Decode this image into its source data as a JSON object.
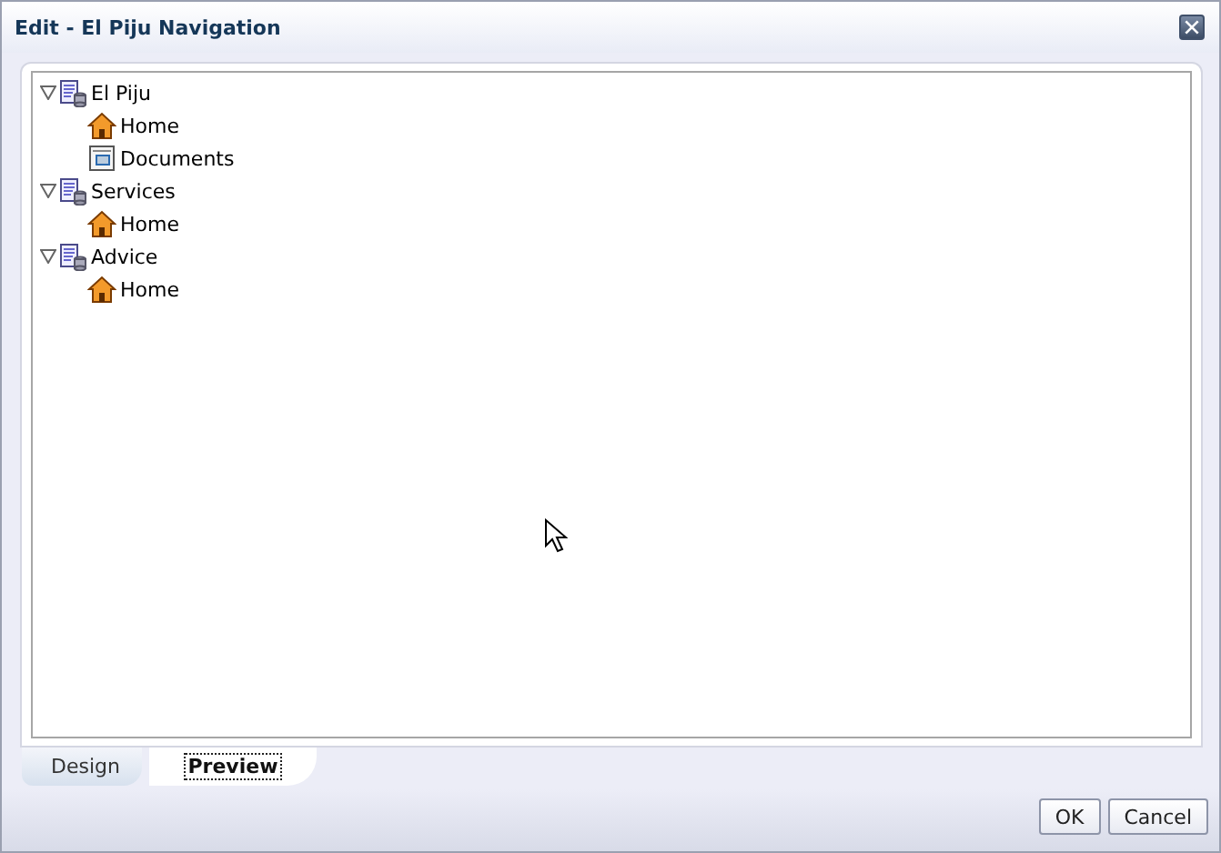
{
  "window": {
    "title": "Edit - El Piju Navigation"
  },
  "tree": [
    {
      "label": "El Piju",
      "kind": "site",
      "expanded": true,
      "children": [
        {
          "label": "Home",
          "kind": "home"
        },
        {
          "label": "Documents",
          "kind": "document"
        }
      ]
    },
    {
      "label": "Services",
      "kind": "site",
      "expanded": true,
      "children": [
        {
          "label": "Home",
          "kind": "home"
        }
      ]
    },
    {
      "label": "Advice",
      "kind": "site",
      "expanded": true,
      "children": [
        {
          "label": "Home",
          "kind": "home"
        }
      ]
    }
  ],
  "tabs": [
    {
      "label": "Design",
      "selected": false
    },
    {
      "label": "Preview",
      "selected": true
    }
  ],
  "buttons": [
    "OK",
    "Cancel"
  ]
}
